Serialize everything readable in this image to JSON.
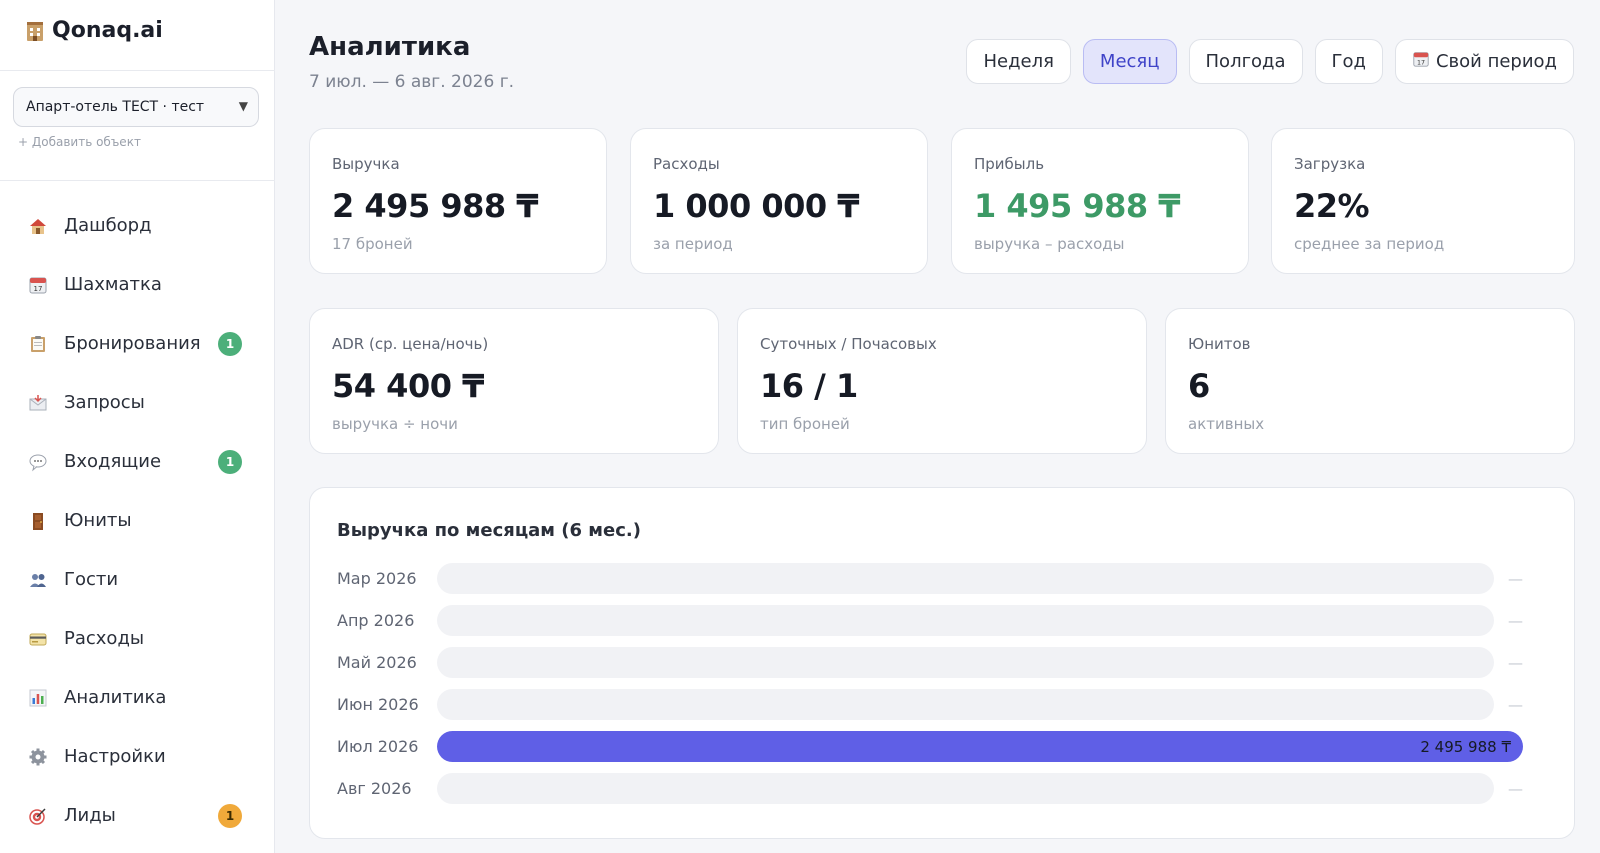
{
  "brand": {
    "name": "Qonaq.ai",
    "icon": "hotel-icon"
  },
  "property_select": {
    "value": "Апарт-отель ТЕСТ · тест",
    "add_label": "+ Добавить объект"
  },
  "nav": [
    {
      "label": "Дашборд",
      "icon": "house-icon",
      "badge": null
    },
    {
      "label": "Шахматка",
      "icon": "calendar-icon",
      "badge": null
    },
    {
      "label": "Бронирования",
      "icon": "clipboard-icon",
      "badge": "1"
    },
    {
      "label": "Запросы",
      "icon": "envelope-icon",
      "badge": null
    },
    {
      "label": "Входящие",
      "icon": "chat-bubble-icon",
      "badge": "1"
    },
    {
      "label": "Юниты",
      "icon": "door-icon",
      "badge": null
    },
    {
      "label": "Гости",
      "icon": "people-icon",
      "badge": null
    },
    {
      "label": "Расходы",
      "icon": "credit-card-icon",
      "badge": null
    },
    {
      "label": "Аналитика",
      "icon": "bar-chart-icon",
      "badge": null
    },
    {
      "label": "Настройки",
      "icon": "gear-icon",
      "badge": null
    },
    {
      "label": "Лиды",
      "icon": "target-icon",
      "badge": "1"
    }
  ],
  "header": {
    "title": "Аналитика",
    "subtitle": "7 июл. — 6 авг. 2026 г."
  },
  "periods": [
    {
      "label": "Неделя",
      "active": false
    },
    {
      "label": "Месяц",
      "active": true
    },
    {
      "label": "Полгода",
      "active": false
    },
    {
      "label": "Год",
      "active": false
    },
    {
      "label": "Свой период",
      "active": false,
      "icon": "calendar-icon"
    }
  ],
  "kpis_row1": [
    {
      "label": "Выручка",
      "value": "2 495 988 ₸",
      "sub": "17 броней",
      "accent": false
    },
    {
      "label": "Расходы",
      "value": "1 000 000 ₸",
      "sub": "за период",
      "accent": false
    },
    {
      "label": "Прибыль",
      "value": "1 495 988 ₸",
      "sub": "выручка – расходы",
      "accent": true
    },
    {
      "label": "Загрузка",
      "value": "22%",
      "sub": "среднее за период",
      "accent": false
    }
  ],
  "kpis_row2": [
    {
      "label": "ADR (ср. цена/ночь)",
      "value": "54 400 ₸",
      "sub": "выручка ÷ ночи"
    },
    {
      "label": "Суточных / Почасовых",
      "value": "16 / 1",
      "sub": "тип броней"
    },
    {
      "label": "Юнитов",
      "value": "6",
      "sub": "активных"
    }
  ],
  "colors": {
    "accent": "#5f5fe6",
    "profit": "#3d9a66",
    "track": "#f1f2f5"
  },
  "chart_data": {
    "type": "bar",
    "orientation": "horizontal",
    "title": "Выручка по месяцам (6 мес.)",
    "categories": [
      "Мар 2026",
      "Апр 2026",
      "Май 2026",
      "Июн 2026",
      "Июл 2026",
      "Авг 2026"
    ],
    "values": [
      0,
      0,
      0,
      0,
      2495988,
      0
    ],
    "value_labels": [
      "—",
      "—",
      "—",
      "—",
      "2 495 988 ₸",
      "—"
    ],
    "xlim": [
      0,
      2495988
    ],
    "grid": false
  }
}
